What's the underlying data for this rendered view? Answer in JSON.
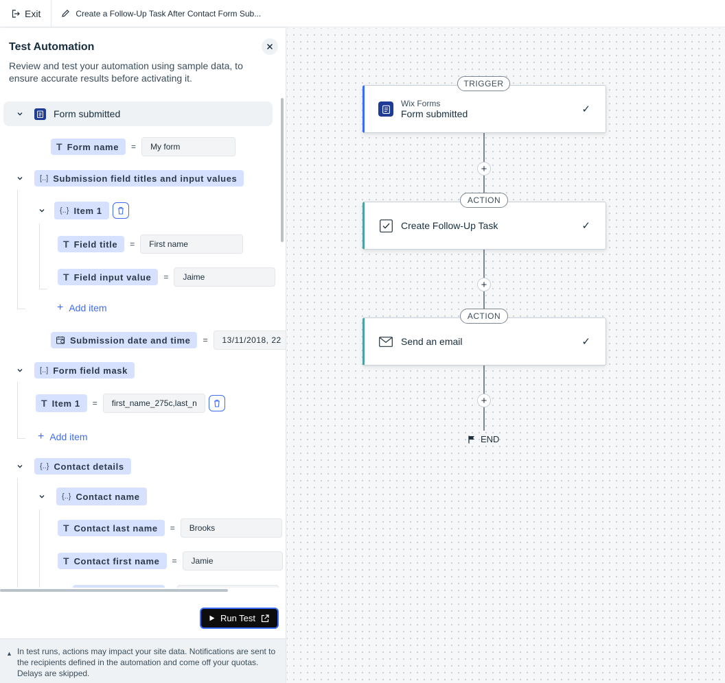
{
  "topbar": {
    "exit_label": "Exit",
    "automation_title": "Create a Follow-Up Task After Contact Form Sub..."
  },
  "panel": {
    "title": "Test Automation",
    "description": "Review and test your automation using sample data, to ensure accurate results before activating it.",
    "trigger_label": "Form submitted",
    "form_name": {
      "label": "Form name",
      "value": "My form"
    },
    "submission_fields": {
      "label": "Submission field titles and input values",
      "item_label": "Item 1",
      "field_title": {
        "label": "Field title",
        "value": "First name"
      },
      "field_input": {
        "label": "Field input value",
        "value": "Jaime"
      },
      "add_item": "Add item"
    },
    "submission_date": {
      "label": "Submission date and time",
      "value": "13/11/2018, 22"
    },
    "form_field_mask": {
      "label": "Form field mask",
      "item_label": "Item 1",
      "item_value": "first_name_275c,last_n",
      "add_item": "Add item"
    },
    "contact_details": {
      "label": "Contact details",
      "contact_name": {
        "label": "Contact name",
        "last_name": {
          "label": "Contact last name",
          "value": "Brooks"
        },
        "first_name": {
          "label": "Contact first name",
          "value": "Jamie"
        }
      }
    },
    "run_test_label": "Run Test",
    "notice": "In test runs, actions may impact your site data. Notifications are sent to the recipients defined in the automation and come off your quotas. Delays are skipped."
  },
  "flow": {
    "trigger_tag": "TRIGGER",
    "trigger_app": "Wix Forms",
    "trigger_name": "Form submitted",
    "action1_tag": "ACTION",
    "action1_name": "Create Follow-Up Task",
    "action2_tag": "ACTION",
    "action2_name": "Send an email",
    "end_label": "END",
    "check_glyph": "✓",
    "plus_glyph": "+"
  },
  "colors": {
    "accent_blue": "#3b6cf7",
    "pill_bg": "#d6e1ff",
    "trigger_border": "#3b6cf7",
    "action_border": "#4aa3a0"
  }
}
